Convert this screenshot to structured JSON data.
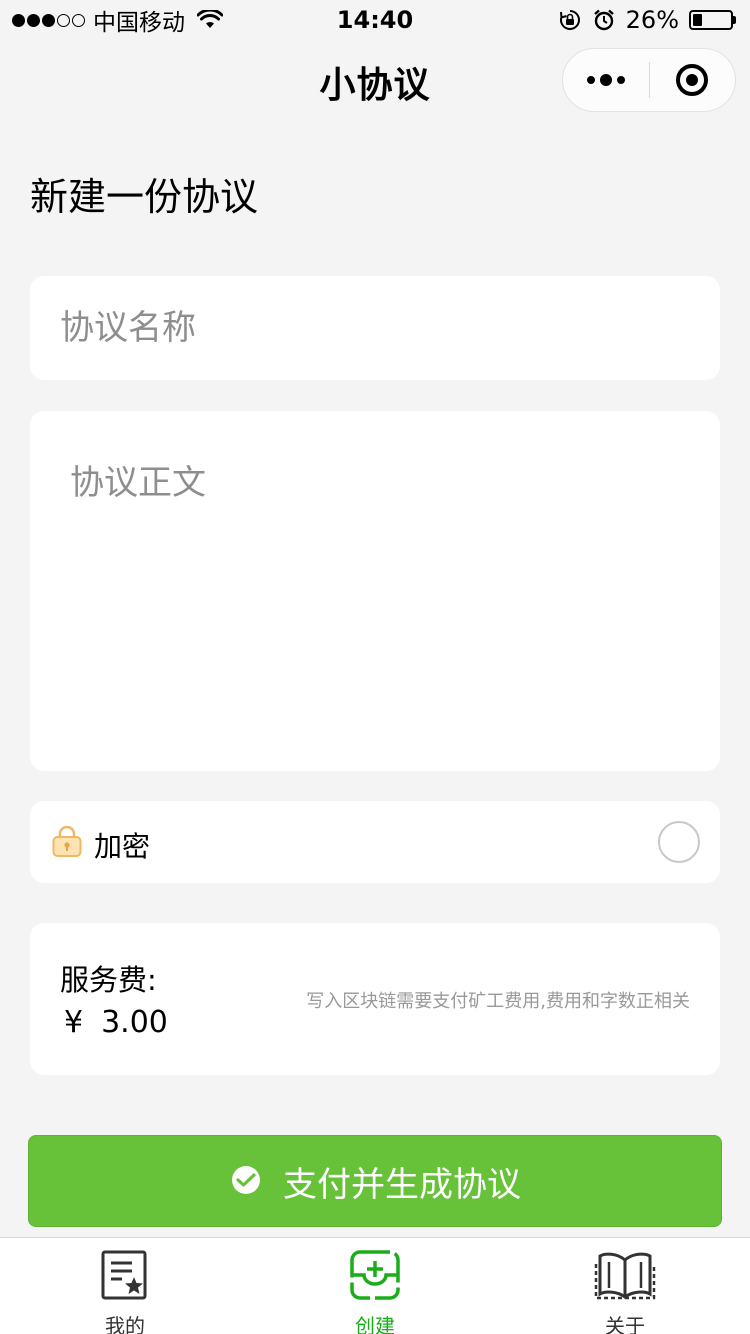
{
  "status_bar": {
    "carrier": "中国移动",
    "time": "14:40",
    "battery": "26%",
    "battery_level": 0.26
  },
  "nav": {
    "title": "小协议",
    "more_icon": "more-dots-icon",
    "close_icon": "target-close-icon"
  },
  "heading": "新建一份协议",
  "form": {
    "name_placeholder": "协议名称",
    "name_value": "",
    "body_placeholder": "协议正文",
    "body_value": "",
    "encrypt_label": "加密",
    "encrypt_checked": false
  },
  "fee": {
    "label": "服务费:",
    "currency": "¥",
    "amount": "3.00",
    "note": "写入区块链需要支付矿工费用,费用和字数正相关"
  },
  "pay_button": {
    "label": "支付并生成协议"
  },
  "tabs": [
    {
      "label": "我的",
      "icon": "document-star-icon",
      "active": false
    },
    {
      "label": "创建",
      "icon": "add-box-icon",
      "active": true
    },
    {
      "label": "关于",
      "icon": "book-icon",
      "active": false
    }
  ],
  "colors": {
    "accent": "#67c23a",
    "tab_active": "#1aad19",
    "background": "#f4f4f4"
  }
}
